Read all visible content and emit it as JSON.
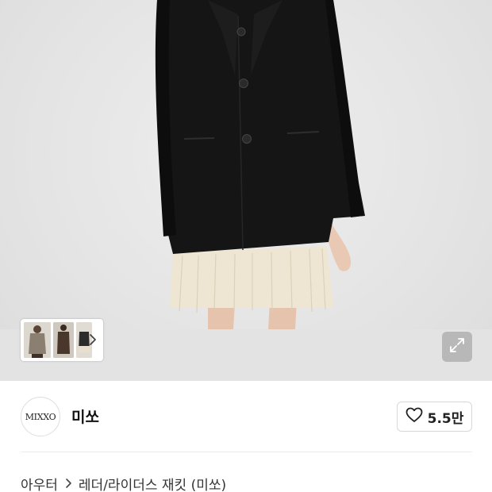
{
  "product": {
    "image_alt": "black blazer over cream fringe skirt",
    "thumbnails": [
      "thumb-1",
      "thumb-2",
      "thumb-3"
    ],
    "thumbs_next_icon": "chevron-right-icon",
    "expand_icon": "expand-icon"
  },
  "brand": {
    "logo_text": "MIXXO",
    "name": "미쏘",
    "likes": "5.5만",
    "like_icon": "heart-icon"
  },
  "breadcrumb": {
    "category": "아우터",
    "subcategory": "레더/라이더스 재킷 (미쏘)",
    "separator_icon": "chevron-right-icon"
  },
  "colors": {
    "jacket": "#151515",
    "skirt": "#eee6d3",
    "skin": "#e9c9b4",
    "background": "#e6e6e6"
  }
}
